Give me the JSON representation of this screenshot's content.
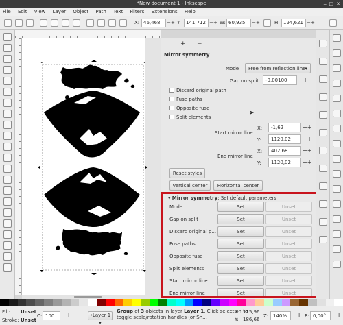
{
  "window": {
    "title": "*New document 1 - Inkscape"
  },
  "menu": [
    "File",
    "Edit",
    "View",
    "Layer",
    "Object",
    "Path",
    "Text",
    "Filters",
    "Extensions",
    "Help"
  ],
  "toolbar": {
    "x_label": "X:",
    "x_value": "46,468",
    "y_label": "Y:",
    "y_value": "141,712",
    "w_label": "W:",
    "w_value": "60,935",
    "h_label": "H:",
    "h_value": "124,621"
  },
  "dialog": {
    "add_symbol": "+",
    "remove_symbol": "−",
    "section_title": "Mirror symmetry",
    "mode_label": "Mode",
    "mode_value": "Free from reflection line",
    "gap_label": "Gap on split",
    "gap_value": "-0,00100",
    "checkboxes": [
      "Discard original path",
      "Fuse paths",
      "Opposite fuse",
      "Split elements"
    ],
    "start_label": "Start mirror line",
    "start_x_label": "X:",
    "start_x": "-1,62",
    "start_y_label": "Y:",
    "start_y": "1120,02",
    "end_label": "End mirror line",
    "end_x_label": "X:",
    "end_x": "402,68",
    "end_y_label": "Y:",
    "end_y": "1120,02",
    "reset_label": "Reset styles",
    "vertical_center_label": "Vertical center",
    "horizontal_center_label": "Horizontal center",
    "defaults_title": "Mirror symmetry",
    "defaults_subtitle": ": Set default parameters",
    "defaults_rows": [
      {
        "label": "Mode",
        "set": "Set",
        "unset": "Unset"
      },
      {
        "label": "Gap on split",
        "set": "Set",
        "unset": "Unset"
      },
      {
        "label": "Discard original p...",
        "set": "Set",
        "unset": "Unset"
      },
      {
        "label": "Fuse paths",
        "set": "Set",
        "unset": "Unset"
      },
      {
        "label": "Opposite fuse",
        "set": "Set",
        "unset": "Unset"
      },
      {
        "label": "Split elements",
        "set": "Set",
        "unset": "Unset"
      },
      {
        "label": "Start mirror line",
        "set": "Set",
        "unset": "Unset"
      },
      {
        "label": "End mirror line",
        "set": "Set",
        "unset": "Unset"
      }
    ]
  },
  "status": {
    "fill_label": "Fill:",
    "fill_value": "Unset",
    "stroke_label": "Stroke:",
    "stroke_value": "Unset",
    "opacity_label": "O:",
    "opacity_value": "100",
    "layer_value": "•Layer 1",
    "message_prefix": "Group",
    "message_mid": " of ",
    "message_count": "3",
    "message_mid2": " objects in layer ",
    "message_layer": "Layer 1",
    "message_rest": ". Click selection to toggle scale/rotation handles (or Sh...",
    "cursor_x_label": "X:",
    "cursor_x": "115,96",
    "cursor_y_label": "Y:",
    "cursor_y": "186,66",
    "zoom_label": "Z:",
    "zoom_value": "140%",
    "rotate_label": "R:",
    "rotate_value": "0,00°"
  },
  "colors": {
    "highlight": "#c8141d"
  }
}
